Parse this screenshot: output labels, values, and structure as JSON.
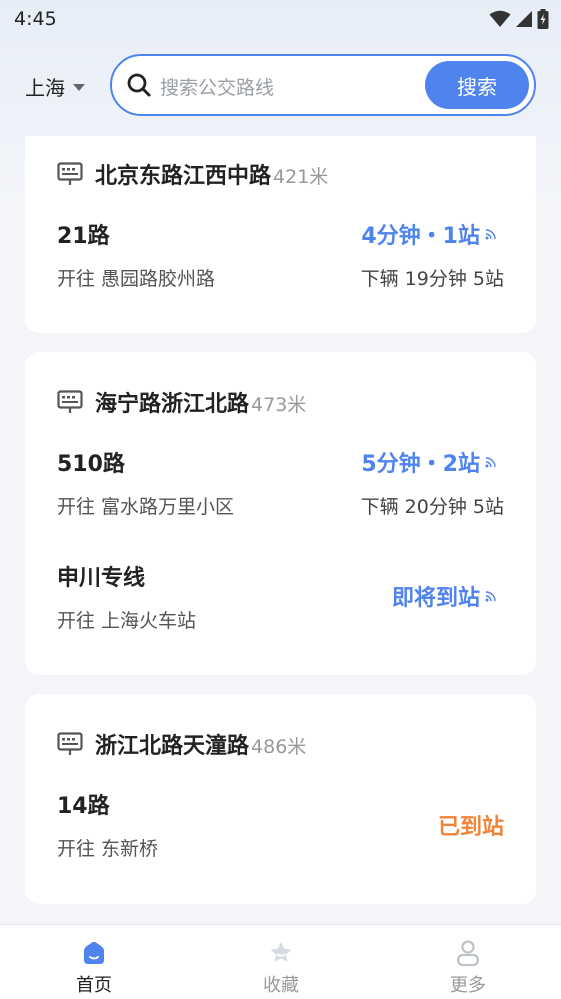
{
  "status_bar": {
    "time": "4:45"
  },
  "header": {
    "city": "上海",
    "search_placeholder": "搜索公交路线",
    "search_button": "搜索"
  },
  "stations": [
    {
      "name": "北京东路江西中路",
      "distance": "421米",
      "routes": [
        {
          "name": "21路",
          "direction": "开往 愚园路胶州路",
          "eta": "4分钟・1站",
          "eta_detail": "下辆 19分钟 5站"
        }
      ]
    },
    {
      "name": "海宁路浙江北路",
      "distance": "473米",
      "routes": [
        {
          "name": "510路",
          "direction": "开往 富水路万里小区",
          "eta": "5分钟・2站",
          "eta_detail": "下辆 20分钟 5站"
        },
        {
          "name": "申川专线",
          "direction": "开往 上海火车站",
          "eta": "即将到站",
          "eta_detail": ""
        }
      ]
    },
    {
      "name": "浙江北路天潼路",
      "distance": "486米",
      "routes": [
        {
          "name": "14路",
          "direction": "开往 东新桥",
          "eta": "已到站",
          "eta_detail": ""
        }
      ]
    }
  ],
  "tabbar": {
    "items": [
      {
        "label": "首页",
        "icon": "home-icon",
        "active": true
      },
      {
        "label": "收藏",
        "icon": "star-icon",
        "active": false
      },
      {
        "label": "更多",
        "icon": "user-icon",
        "active": false
      }
    ]
  },
  "colors": {
    "accent": "#4f83ee",
    "arrived": "#f0853a"
  }
}
